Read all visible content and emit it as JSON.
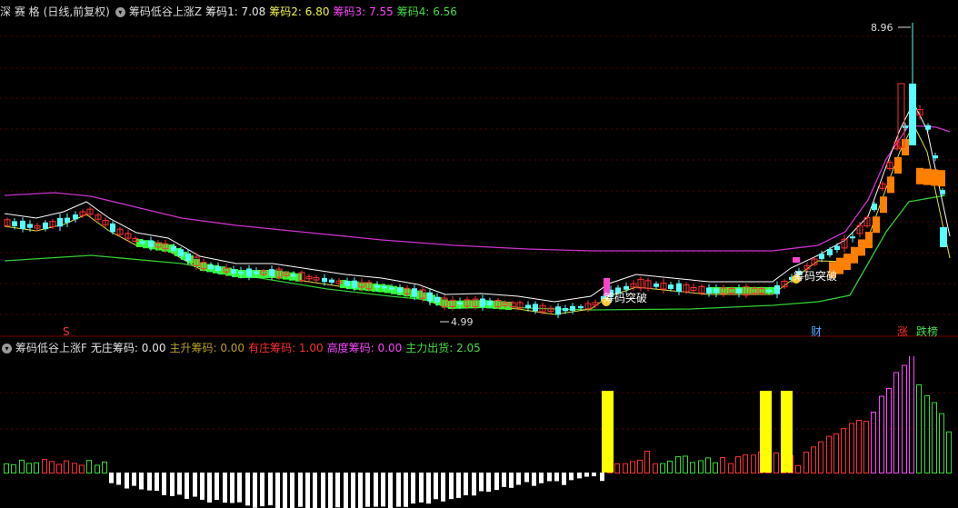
{
  "top_header": {
    "stock_name": "深 赛 格",
    "period": "(日线,前复权)",
    "indicator_name": "筹码低谷上涨Z",
    "items": [
      {
        "label": "筹码1:",
        "value": "7.08",
        "color": "#e8e8e8"
      },
      {
        "label": "筹码2:",
        "value": "6.80",
        "color": "#f0f050"
      },
      {
        "label": "筹码3:",
        "value": "7.55",
        "color": "#ff44ff"
      },
      {
        "label": "筹码4:",
        "value": "6.56",
        "color": "#44dd44"
      }
    ]
  },
  "bottom_header": {
    "indicator_name": "筹码低谷上涨F",
    "items": [
      {
        "label": "无庄筹码:",
        "value": "0.00",
        "color": "#e8e8e8"
      },
      {
        "label": "主升筹码:",
        "value": "0.00",
        "color": "#b8a020"
      },
      {
        "label": "有庄筹码:",
        "value": "1.00",
        "color": "#ff3030"
      },
      {
        "label": "高度筹码:",
        "value": "0.00",
        "color": "#ff44ff"
      },
      {
        "label": "主力出货:",
        "value": "2.05",
        "color": "#44dd44"
      }
    ]
  },
  "annotations": {
    "high_price": "8.96",
    "low_price": "4.99",
    "breakout_1": "筹码突破",
    "breakout_2": "筹码突破",
    "marker_s": "S",
    "tag_cai": "财",
    "tag_zhang": "涨",
    "tag_diebang": "跌榜"
  },
  "colors": {
    "up": "#ff3030",
    "down": "#55ffff",
    "band_green": "#33ff33",
    "band_orange": "#ff8000",
    "upper_line": "#cc33cc",
    "lower_line": "#33cc33",
    "ma_white": "#ffffff",
    "ma_yellow": "#e0e040",
    "hist_white": "#ffffff",
    "hist_green": "#33dd33",
    "hist_red": "#ff3030",
    "hist_magenta": "#ff44ff",
    "hist_yellow": "#ffff00"
  },
  "chart_data": {
    "type": "candlestick",
    "y_axis": "price",
    "price_high": 8.96,
    "price_low": 4.99,
    "legend": [
      "筹码1",
      "筹码2",
      "筹码3",
      "筹码4"
    ],
    "indicator_type": "bar",
    "indicator_legend": [
      "无庄筹码",
      "主升筹码",
      "有庄筹码",
      "高度筹码",
      "主力出货"
    ]
  }
}
